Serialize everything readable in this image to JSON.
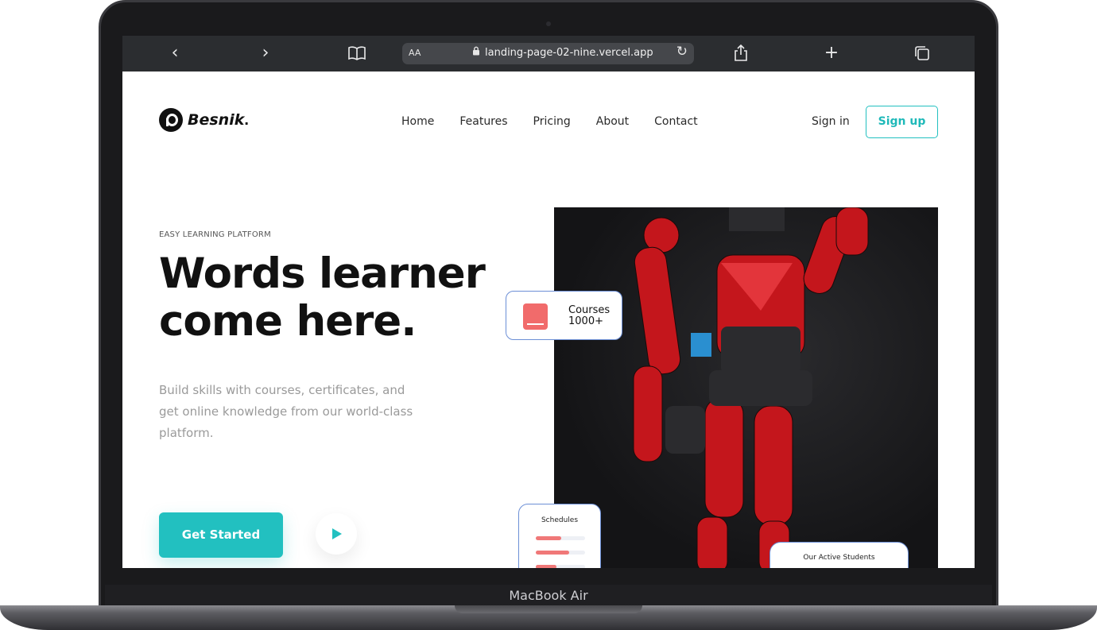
{
  "device": {
    "label": "MacBook Air"
  },
  "browser": {
    "text_size_label": "AA",
    "url": "landing-page-02-nine.vercel.app"
  },
  "brand": {
    "name": "Besnik",
    "dot": "."
  },
  "nav": {
    "items": [
      {
        "label": "Home"
      },
      {
        "label": "Features"
      },
      {
        "label": "Pricing"
      },
      {
        "label": "About"
      },
      {
        "label": "Contact"
      }
    ],
    "sign_in": "Sign in",
    "sign_up": "Sign up"
  },
  "hero": {
    "eyebrow": "EASY LEARNING PLATFORM",
    "headline_line1": "Words learner",
    "headline_line2": "come here.",
    "subtext": "Build skills with courses, certificates, and get online knowledge from our world-class platform.",
    "cta": "Get Started"
  },
  "cards": {
    "courses": {
      "line1": "Courses",
      "line2": "1000+"
    },
    "schedules": {
      "title": "Schedules"
    },
    "students": {
      "title": "Our Active Students"
    }
  },
  "colors": {
    "accent": "#22c0c0",
    "card_icon": "#f16b6b"
  }
}
